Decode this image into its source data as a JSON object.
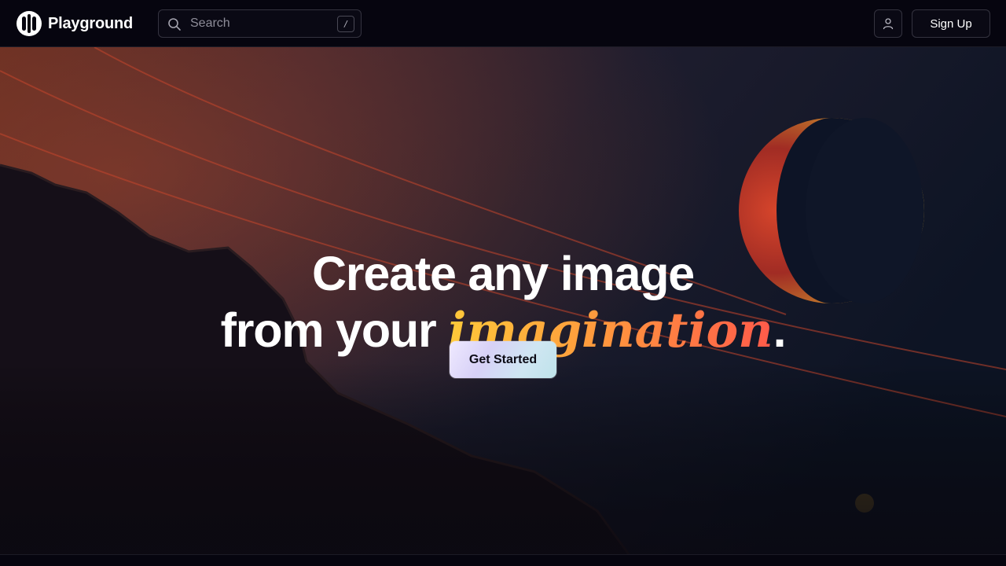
{
  "app": {
    "name": "Playground"
  },
  "search": {
    "placeholder": "Search",
    "shortcut": "/"
  },
  "header": {
    "signup_label": "Sign Up",
    "user_icon": "user-icon"
  },
  "hero": {
    "line1": "Create any image",
    "line2_prefix": "from your ",
    "line2_accent": "imagination",
    "line2_suffix": ".",
    "cta_label": "Get Started"
  },
  "colors": {
    "background": "#05040c",
    "accent_start": "#ffc93a",
    "accent_end": "#ff5a4a",
    "cta_start": "#efe9ff",
    "cta_end": "#bfe3ea"
  }
}
